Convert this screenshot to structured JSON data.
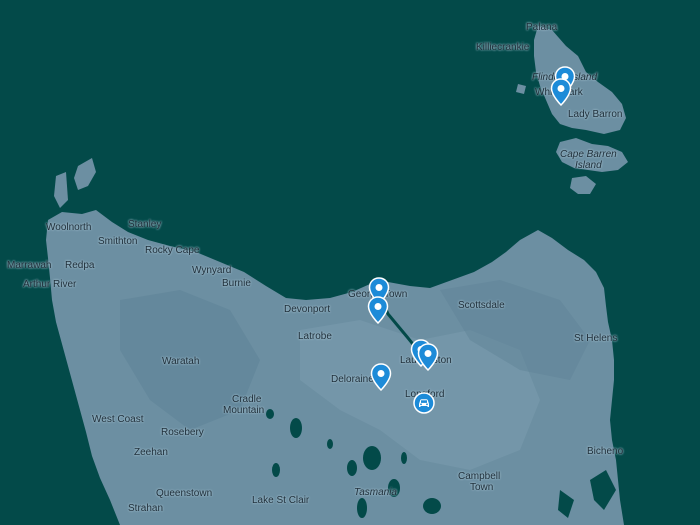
{
  "map": {
    "colors": {
      "water": "#034a49",
      "land": "#6c8fa2",
      "land_light": "#7a9bad",
      "marker": "#1d8bd8"
    },
    "labels": {
      "palana": "Palana",
      "killiecrankie": "Killiecrankie",
      "flinders_island": "Flinders Island",
      "whitemark": "Whitemark",
      "lady_barron": "Lady Barron",
      "cape_barren_1": "Cape Barren",
      "cape_barren_2": "Island",
      "woolnorth": "Woolnorth",
      "stanley": "Stanley",
      "smithton": "Smithton",
      "rocky_cape": "Rocky Cape",
      "marrawah": "Marrawah",
      "redpa": "Redpa",
      "wynyard": "Wynyard",
      "arthur_river": "Arthur River",
      "burnie": "Burnie",
      "george_town": "George Town",
      "devonport": "Devonport",
      "scottsdale": "Scottsdale",
      "latrobe": "Latrobe",
      "st_helens": "St Helens",
      "launceston": "Launceston",
      "waratah": "Waratah",
      "deloraine": "Deloraine",
      "longford": "Longford",
      "cradle_1": "Cradle",
      "cradle_2": "Mountain",
      "west_coast": "West Coast",
      "rosebery": "Rosebery",
      "zeehan": "Zeehan",
      "bicheno": "Bicheno",
      "campbell_1": "Campbell",
      "campbell_2": "Town",
      "tasmania": "Tasmania",
      "queenstown": "Queenstown",
      "lake_st_clair": "Lake St Clair",
      "strahan": "Strahan"
    },
    "markers": [
      {
        "icon": "map-pin-icon"
      },
      {
        "icon": "map-pin-icon"
      },
      {
        "icon": "map-pin-icon"
      },
      {
        "icon": "map-pin-icon"
      },
      {
        "icon": "map-pin-icon"
      },
      {
        "icon": "map-pin-icon"
      },
      {
        "icon": "map-pin-icon"
      },
      {
        "icon": "car-icon"
      }
    ]
  }
}
